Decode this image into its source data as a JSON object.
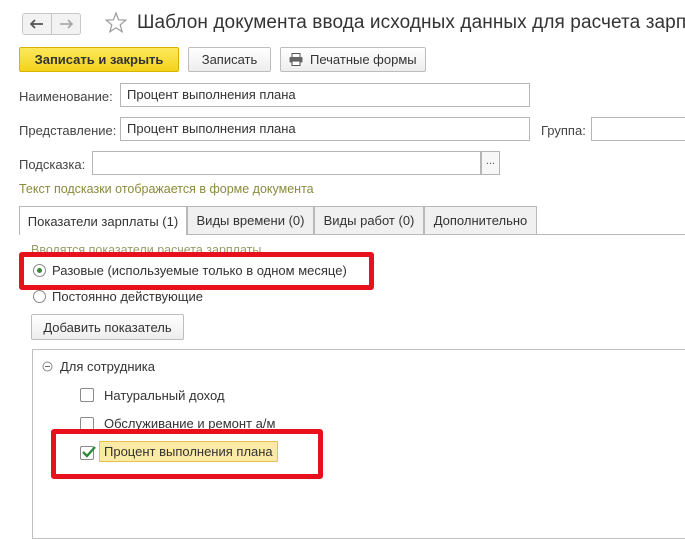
{
  "header": {
    "title": "Шаблон документа ввода исходных данных для расчета зарпла"
  },
  "toolbar": {
    "save_close_label": "Записать и закрыть",
    "save_label": "Записать",
    "print_label": "Печатные формы"
  },
  "form": {
    "name_label": "Наименование:",
    "name_value": "Процент выполнения плана",
    "presentation_label": "Представление:",
    "presentation_value": "Процент выполнения плана",
    "group_label": "Группа:",
    "group_value": "",
    "hint_label": "Подсказка:",
    "hint_value": "",
    "hint_button": "...",
    "hint_note": "Текст подсказки отображается в форме документа"
  },
  "tabs": [
    {
      "label": "Показатели зарплаты (1)",
      "active": true
    },
    {
      "label": "Виды времени (0)",
      "active": false
    },
    {
      "label": "Виды работ (0)",
      "active": false
    },
    {
      "label": "Дополнительно",
      "active": false
    }
  ],
  "indicators": {
    "intro_text": "Вводятся показатели расчета зарплаты",
    "options": [
      {
        "label": "Разовые (используемые только в одном месяце)",
        "selected": true
      },
      {
        "label": "Постоянно действующие",
        "selected": false
      }
    ],
    "add_button": "Добавить показатель"
  },
  "tree": {
    "group_label": "Для сотрудника",
    "items": [
      {
        "label": "Натуральный доход",
        "checked": false
      },
      {
        "label": "Обслуживание и ремонт а/м",
        "checked": false
      },
      {
        "label": "Процент выполнения плана",
        "checked": true
      }
    ]
  },
  "colors": {
    "primary_button": "#f5d21d",
    "highlight": "#e8101d",
    "hint_text": "#8a8a3c",
    "check": "#2e8b3a"
  }
}
